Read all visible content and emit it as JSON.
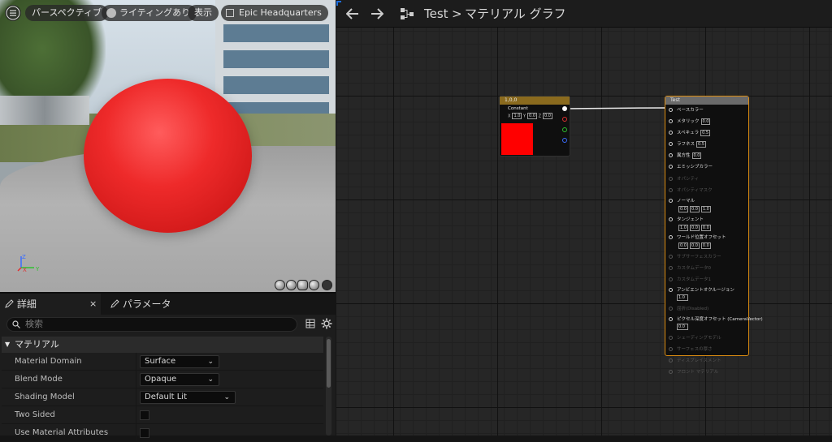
{
  "viewport": {
    "menu_icon": "hamburger-icon",
    "perspective": "パースペクティブ",
    "lighting": "ライティングあり",
    "show": "表示",
    "level": "Epic Headquarters",
    "axis_z": "Z",
    "axis_x": "X",
    "axis_y": "Y"
  },
  "details": {
    "tab_details": "詳細",
    "tab_details_close": "×",
    "tab_params": "パラメータ",
    "search_placeholder": "検索",
    "section": "マテリアル",
    "rows": [
      {
        "label": "Material Domain",
        "value": "Surface"
      },
      {
        "label": "Blend Mode",
        "value": "Opaque"
      },
      {
        "label": "Shading Model",
        "value": "Default Lit"
      },
      {
        "label": "Two Sided",
        "value": ""
      },
      {
        "label": "Use Material Attributes",
        "value": ""
      }
    ]
  },
  "graph": {
    "breadcrumb_asset": "Test",
    "breadcrumb_sep": ">",
    "breadcrumb_graph": "マテリアル グラフ",
    "const_node": {
      "title": "1,0,0",
      "label": "Constant",
      "x_label": "X",
      "x": "1.0",
      "y_label": "Y",
      "y": "0.0",
      "z_label": "Z",
      "z": "0.0",
      "color": "#ff0000"
    },
    "result_node": {
      "title": "Test",
      "pins": [
        {
          "label": "ベースカラー"
        },
        {
          "label": "メタリック",
          "value": "0.0"
        },
        {
          "label": "スペキュラ",
          "value": "0.5"
        },
        {
          "label": "ラフネス",
          "value": "0.5"
        },
        {
          "label": "異方性",
          "value": "0.0"
        },
        {
          "label": "エミッシブカラー"
        },
        {
          "label": "オパシティ",
          "dim": true
        },
        {
          "label": "オパシティマスク",
          "dim": true
        },
        {
          "label": "ノーマル",
          "vx": "0.0",
          "vy": "0.0",
          "vz": "1.0"
        },
        {
          "label": "タンジェント",
          "vx": "1.0",
          "vy": "0.0",
          "vz": "0.0"
        },
        {
          "label": "ワールド位置オフセット",
          "vx": "0.0",
          "vy": "0.0",
          "vz": "0.0"
        },
        {
          "label": "サブサーフェスカラー",
          "dim": true
        },
        {
          "label": "カスタムデータ0",
          "dim": true
        },
        {
          "label": "カスタムデータ1",
          "dim": true
        },
        {
          "label": "アンビエントオクルージョン",
          "value": "1.0"
        },
        {
          "label": "屈折(Disabled)",
          "dim": true
        },
        {
          "label": "ピクセル深度オフセット (CameraVector)",
          "value": "0.0"
        },
        {
          "label": "シェーディングモデル",
          "dim": true
        },
        {
          "label": "サーフェスの厚さ",
          "dim": true
        },
        {
          "label": "ディスプレイスメント",
          "dim": true
        },
        {
          "label": "フロント マテリアル",
          "dim": true
        }
      ]
    }
  }
}
